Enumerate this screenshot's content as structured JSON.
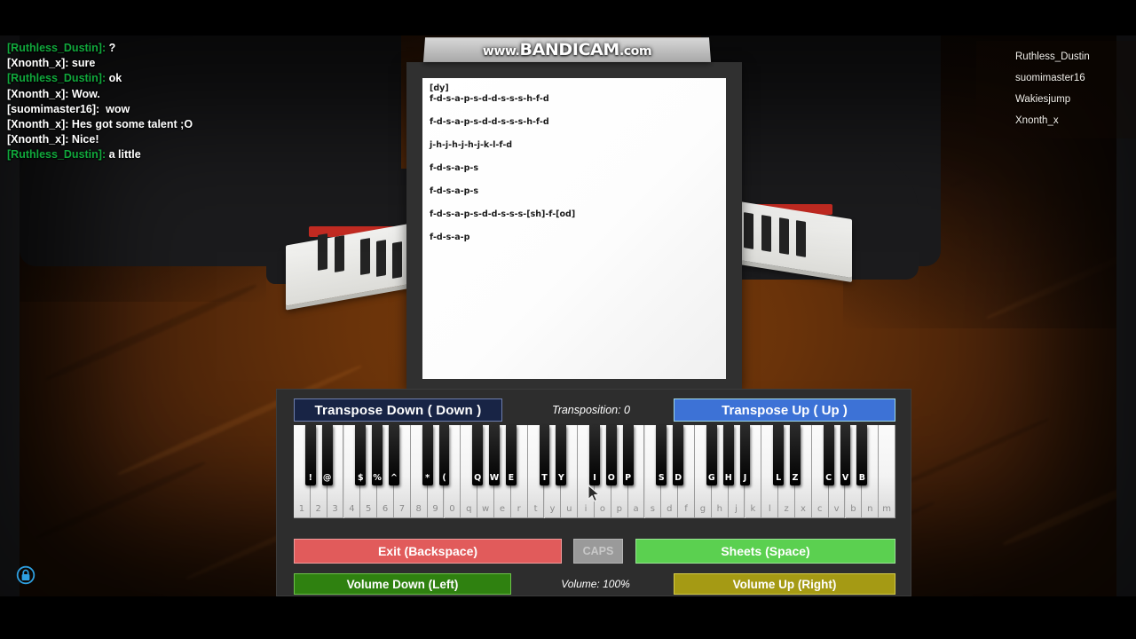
{
  "app": {
    "title": "Roblox Piano (Virtual Piano)",
    "watermark": {
      "prefix": "www.",
      "brand": "BANDICAM",
      "suffix": ".com"
    }
  },
  "colors": {
    "chat_name_green": "#11a83c",
    "chat_text": "#ffffff",
    "transpose_up_bg": "#3d72d6",
    "transpose_down_bg": "#182445",
    "exit_bg": "#e15b5b",
    "sheets_bg": "#5bd050",
    "caps_bg": "#9a9a9a",
    "volume_down_bg": "#2f8110",
    "volume_up_bg": "#a59a14",
    "panel_bg": "#2d2d2d",
    "floor_wood": "#7a3c0c",
    "piano_red_strip": "#c32b22"
  },
  "chat": {
    "messages": [
      {
        "name": "[Ruthless_Dustin]:",
        "text": " ?",
        "green": true
      },
      {
        "name": "[Xnonth_x]:",
        "text": " sure",
        "green": false
      },
      {
        "name": "[Ruthless_Dustin]:",
        "text": " ok",
        "green": true
      },
      {
        "name": "[Xnonth_x]:",
        "text": " Wow.",
        "green": false
      },
      {
        "name": "[suomimaster16]:",
        "text": "  wow",
        "green": false
      },
      {
        "name": "[Xnonth_x]:",
        "text": " Hes got some talent ;O",
        "green": false
      },
      {
        "name": "[Xnonth_x]:",
        "text": " Nice!",
        "green": false
      },
      {
        "name": "[Ruthless_Dustin]:",
        "text": " a little",
        "green": true
      }
    ]
  },
  "playerlist": {
    "players": [
      "Ruthless_Dustin",
      "suomimaster16",
      "Wakiesjump",
      "Xnonth_x"
    ]
  },
  "sheet": {
    "lines": [
      "[dy]",
      "f-d-s-a-p-s-d-d-s-s-s-h-f-d",
      "f-d-s-a-p-s-d-d-s-s-s-h-f-d",
      "j-h-j-h-j-h-j-k-l-f-d",
      "f-d-s-a-p-s",
      "f-d-s-a-p-s",
      "f-d-s-a-p-s-d-d-s-s-s-[sh]-f-[od]",
      "f-d-s-a-p"
    ]
  },
  "piano_ui": {
    "transpose_down_label": "Transpose Down ( Down  )",
    "transposition_label": "Transposition: 0",
    "transpose_up_label": "Transpose Up (  Up  )",
    "exit_label": "Exit (Backspace)",
    "caps_label": "CAPS",
    "sheets_label": "Sheets (Space)",
    "volume_down_label": "Volume Down (Left)",
    "volume_label": "Volume: 100%",
    "volume_up_label": "Volume Up (Right)",
    "white_keys": [
      "1",
      "2",
      "3",
      "4",
      "5",
      "6",
      "7",
      "8",
      "9",
      "0",
      "q",
      "w",
      "e",
      "r",
      "t",
      "y",
      "u",
      "i",
      "o",
      "p",
      "a",
      "s",
      "d",
      "f",
      "g",
      "h",
      "j",
      "k",
      "l",
      "z",
      "x",
      "c",
      "v",
      "b",
      "n",
      "m"
    ],
    "black_keys": [
      {
        "label": "!",
        "after": 0
      },
      {
        "label": "@",
        "after": 1
      },
      {
        "label": "$",
        "after": 3
      },
      {
        "label": "%",
        "after": 4
      },
      {
        "label": "^",
        "after": 5
      },
      {
        "label": "*",
        "after": 7
      },
      {
        "label": "(",
        "after": 8
      },
      {
        "label": "Q",
        "after": 10
      },
      {
        "label": "W",
        "after": 11
      },
      {
        "label": "E",
        "after": 12
      },
      {
        "label": "T",
        "after": 14
      },
      {
        "label": "Y",
        "after": 15
      },
      {
        "label": "I",
        "after": 17
      },
      {
        "label": "O",
        "after": 18
      },
      {
        "label": "P",
        "after": 19
      },
      {
        "label": "S",
        "after": 21
      },
      {
        "label": "D",
        "after": 22
      },
      {
        "label": "G",
        "after": 24
      },
      {
        "label": "H",
        "after": 25
      },
      {
        "label": "J",
        "after": 26
      },
      {
        "label": "L",
        "after": 28
      },
      {
        "label": "Z",
        "after": 29
      },
      {
        "label": "C",
        "after": 31
      },
      {
        "label": "V",
        "after": 32
      },
      {
        "label": "B",
        "after": 33
      }
    ]
  },
  "hud": {
    "lock_icon": "lock-icon"
  }
}
